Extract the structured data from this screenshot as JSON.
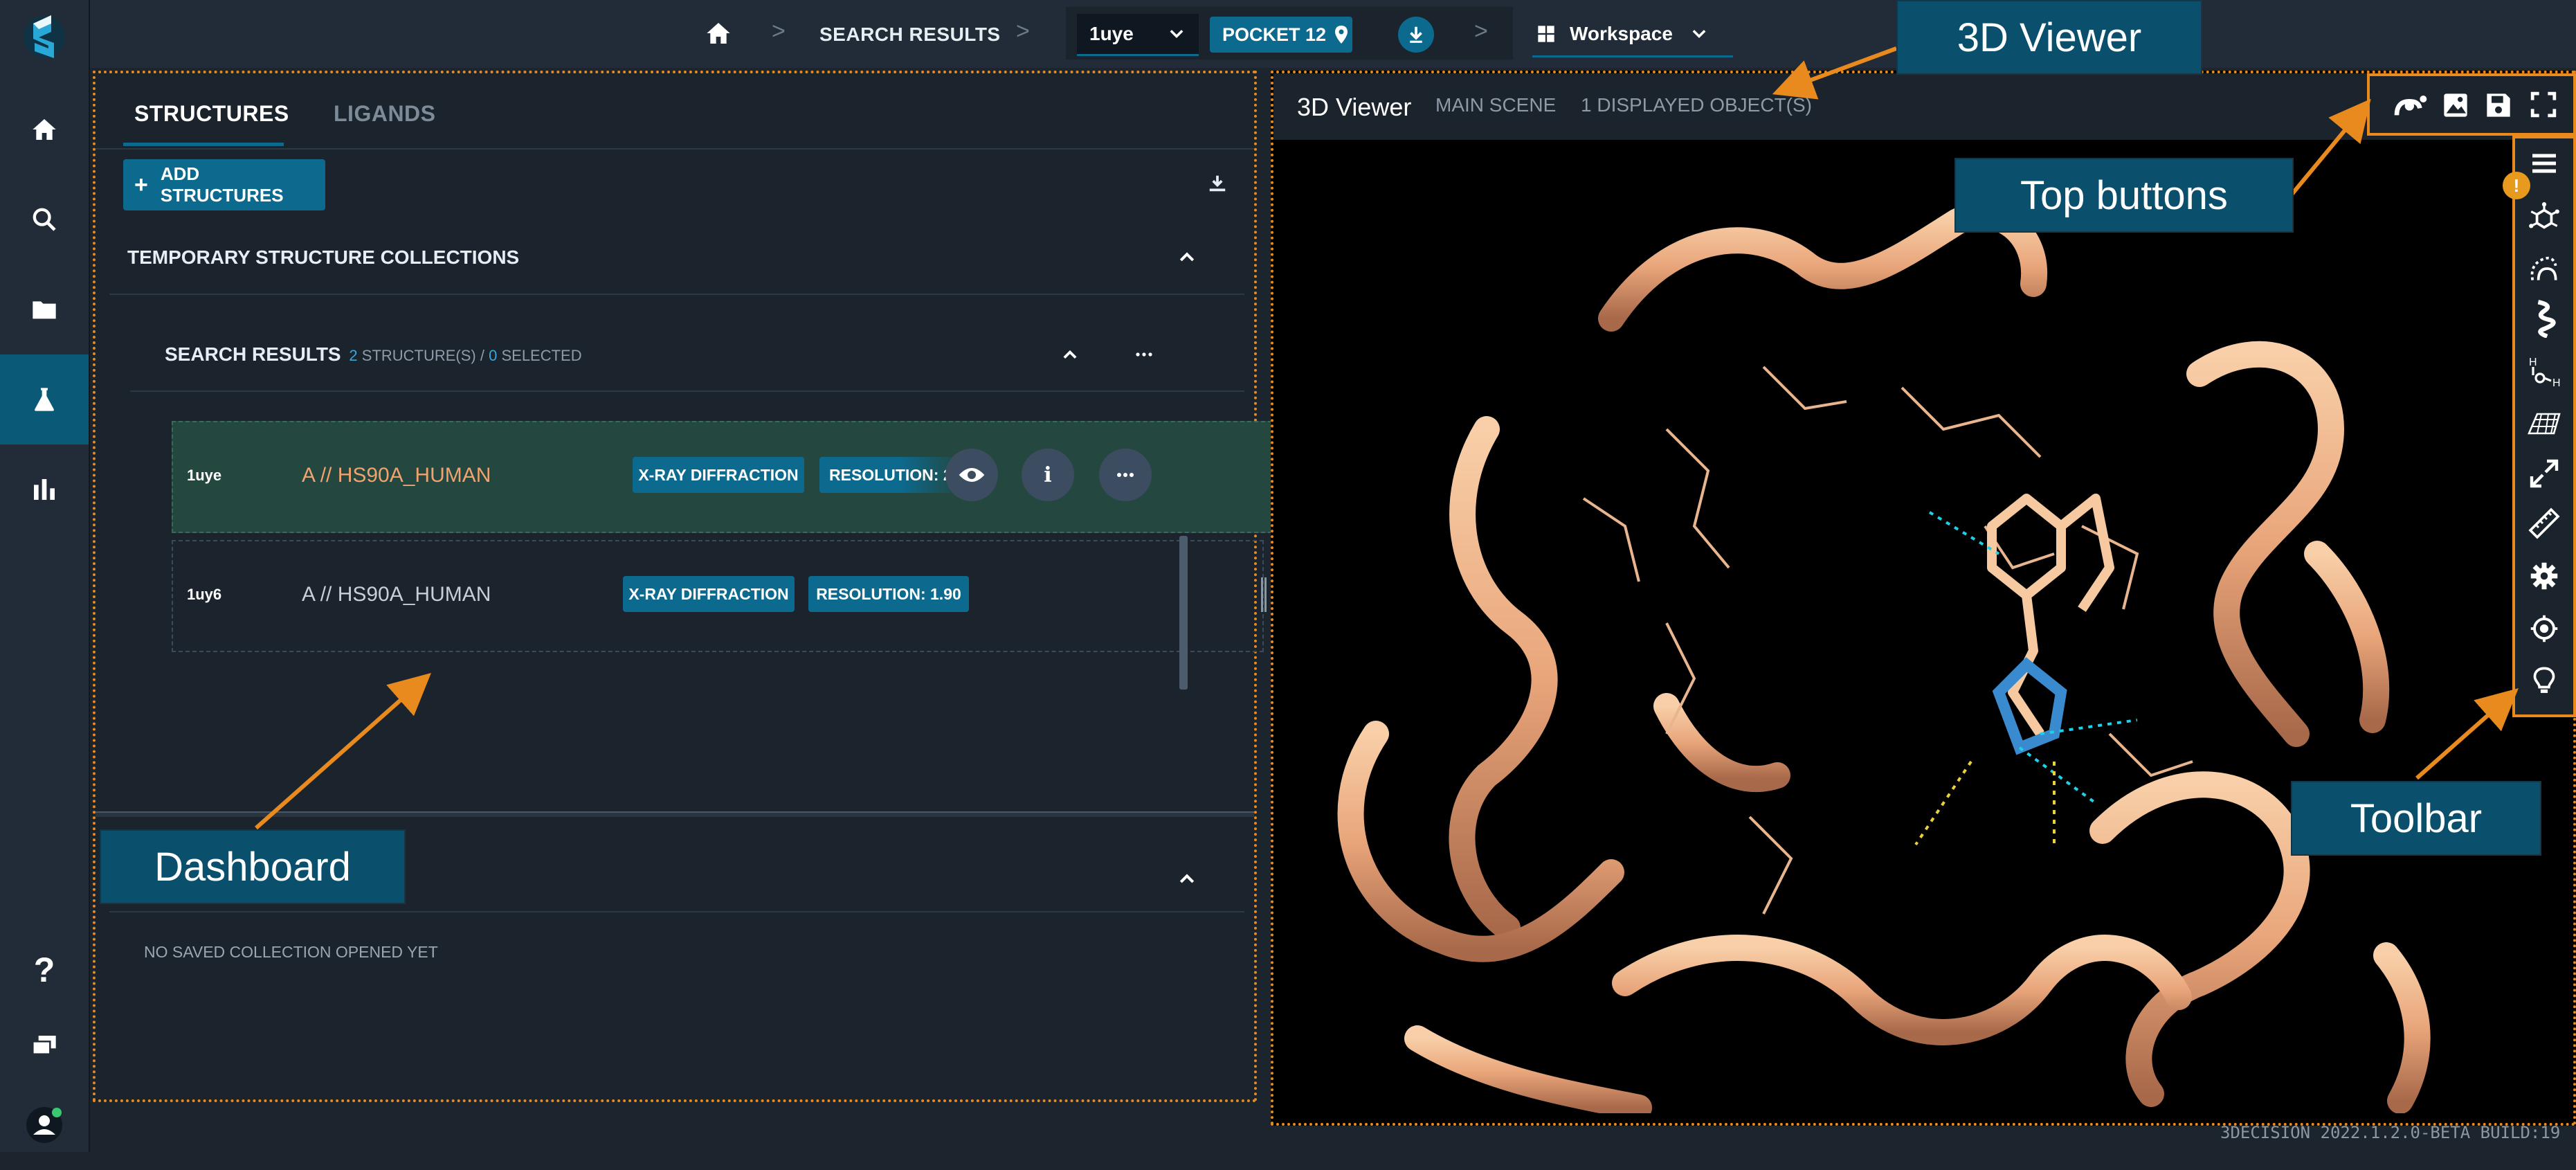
{
  "app": {
    "name": "3Decision",
    "build": "3DECISION 2022.1.2.0-BETA BUILD:19"
  },
  "colors": {
    "accent": "#0c6a8f",
    "highlight": "#e88a1e",
    "protein": "#f1b48a"
  },
  "leftnav": {
    "items": [
      {
        "icon": "home-icon"
      },
      {
        "icon": "search-icon"
      },
      {
        "icon": "folder-icon"
      },
      {
        "icon": "flask-icon",
        "active": true
      },
      {
        "icon": "bar-chart-icon"
      }
    ],
    "bottom": [
      {
        "icon": "help-icon"
      },
      {
        "icon": "chat-icon"
      },
      {
        "icon": "user-icon"
      }
    ]
  },
  "topbar": {
    "crumbs": [
      "SEARCH RESULTS"
    ],
    "structure": "1uye",
    "pocket": "POCKET 12",
    "workspace": "Workspace"
  },
  "dashboard": {
    "tabs": [
      {
        "label": "STRUCTURES",
        "active": true
      },
      {
        "label": "LIGANDS"
      }
    ],
    "add_button": "ADD STRUCTURES",
    "temp_section": "TEMPORARY STRUCTURE COLLECTIONS",
    "search_results": {
      "title": "SEARCH RESULTS",
      "count_num": "2",
      "count_text": " STRUCTURE(S) / ",
      "selected_num": "0",
      "selected_text": " SELECTED"
    },
    "rows": [
      {
        "id": "1uye",
        "name": "A // HS90A_HUMAN",
        "method": "X-RAY DIFFRACTION",
        "resolution": "RESOLUTION: 2",
        "selected": true
      },
      {
        "id": "1uy6",
        "name": "A // HS90A_HUMAN",
        "method": "X-RAY DIFFRACTION",
        "resolution": "RESOLUTION: 1.90"
      }
    ],
    "saved_empty": "NO SAVED COLLECTION OPENED YET"
  },
  "viewer": {
    "title": "3D Viewer",
    "scene": "MAIN SCENE",
    "objects": "1 DISPLAYED OBJECT(S)"
  },
  "callouts": {
    "viewer": "3D Viewer",
    "top_buttons": "Top buttons",
    "toolbar": "Toolbar",
    "dashboard": "Dashboard"
  }
}
